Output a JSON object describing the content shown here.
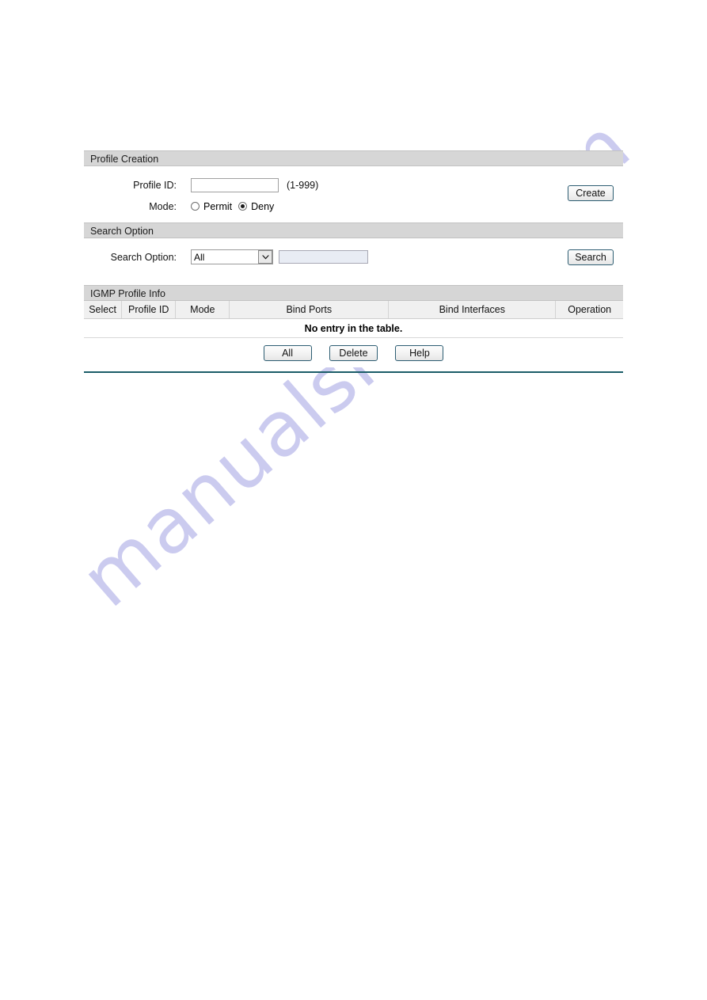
{
  "watermark": {
    "text": "manualshive.com"
  },
  "profile_creation": {
    "section_title": "Profile Creation",
    "profile_id_label": "Profile ID:",
    "profile_id_value": "",
    "profile_id_placeholder": "",
    "profile_id_hint": "(1-999)",
    "mode_label": "Mode:",
    "mode_options": [
      {
        "label": "Permit",
        "selected": false
      },
      {
        "label": "Deny",
        "selected": true
      }
    ],
    "create_button": "Create"
  },
  "search_option": {
    "section_title": "Search Option",
    "label": "Search Option:",
    "select_value": "All",
    "select_options": [
      "All"
    ],
    "keyword_value": "",
    "keyword_placeholder": "",
    "search_button": "Search"
  },
  "igmp_profile_info": {
    "section_title": "IGMP Profile Info",
    "columns": [
      "Select",
      "Profile ID",
      "Mode",
      "Bind Ports",
      "Bind Interfaces",
      "Operation"
    ],
    "empty_message": "No entry in the table.",
    "buttons": [
      "All",
      "Delete",
      "Help"
    ]
  },
  "colors": {
    "section_bar": "#d6d6d6",
    "table_header": "#f0f0f0",
    "button_border": "#2d5d72",
    "bottom_rule": "#1b5d68",
    "disabled_field": "#e8ecf4",
    "watermark": "#c9c9ef"
  }
}
